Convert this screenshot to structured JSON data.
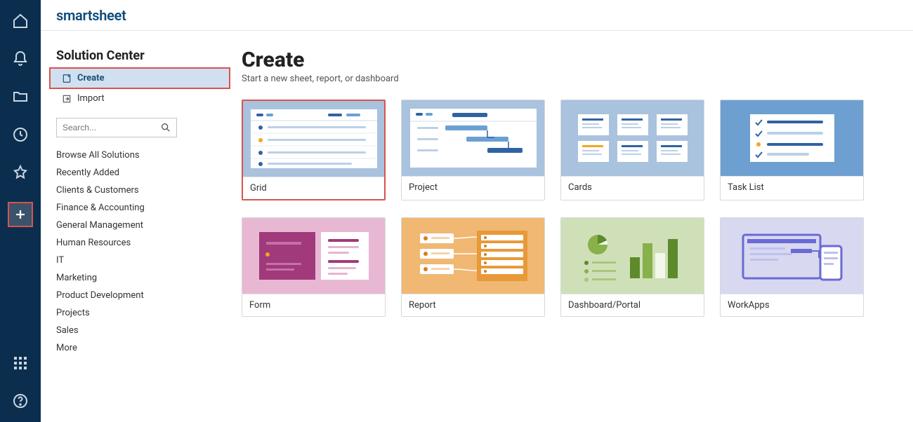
{
  "logo": "smartsheet",
  "sidepanel": {
    "title": "Solution Center",
    "nav": [
      {
        "label": "Create",
        "active": true
      },
      {
        "label": "Import",
        "active": false
      }
    ],
    "search_placeholder": "Search...",
    "links": [
      "Browse All Solutions",
      "Recently Added",
      "Clients & Customers",
      "Finance & Accounting",
      "General Management",
      "Human Resources",
      "IT",
      "Marketing",
      "Product Development",
      "Projects",
      "Sales",
      "More"
    ]
  },
  "create": {
    "title": "Create",
    "subtitle": "Start a new sheet, report, or dashboard",
    "cards": [
      {
        "label": "Grid"
      },
      {
        "label": "Project"
      },
      {
        "label": "Cards"
      },
      {
        "label": "Task List"
      },
      {
        "label": "Form"
      },
      {
        "label": "Report"
      },
      {
        "label": "Dashboard/Portal"
      },
      {
        "label": "WorkApps"
      }
    ]
  }
}
